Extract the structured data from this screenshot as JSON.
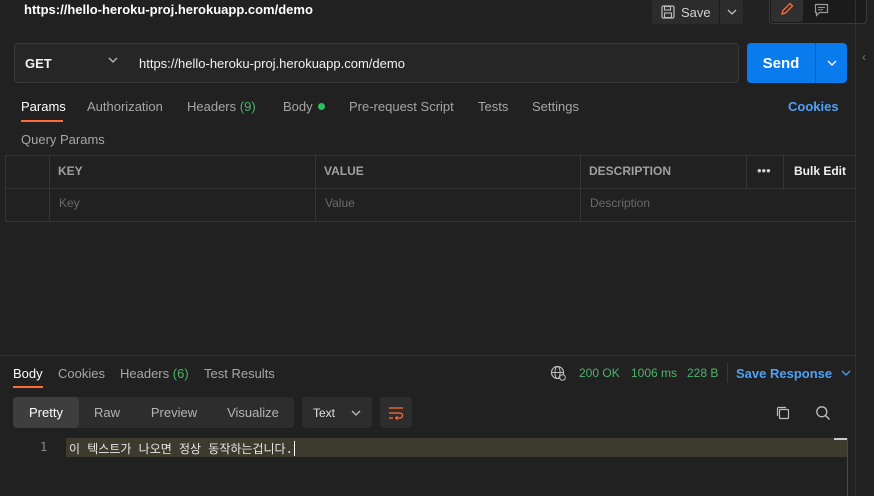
{
  "header": {
    "title": "https://hello-heroku-proj.herokuapp.com/demo",
    "save_label": "Save"
  },
  "request": {
    "method": "GET",
    "url": "https://hello-heroku-proj.herokuapp.com/demo",
    "send_label": "Send"
  },
  "request_tabs": {
    "params": "Params",
    "authorization": "Authorization",
    "headers": "Headers",
    "headers_count": "(9)",
    "body": "Body",
    "prerequest": "Pre-request Script",
    "tests": "Tests",
    "settings": "Settings",
    "cookies": "Cookies"
  },
  "query_params": {
    "title": "Query Params",
    "columns": {
      "key": "KEY",
      "value": "VALUE",
      "description": "DESCRIPTION"
    },
    "more": "•••",
    "bulk_edit": "Bulk Edit",
    "placeholders": {
      "key": "Key",
      "value": "Value",
      "description": "Description"
    }
  },
  "response_tabs": {
    "body": "Body",
    "cookies": "Cookies",
    "headers": "Headers",
    "headers_count": "(6)",
    "test_results": "Test Results"
  },
  "response_status": {
    "status": "200 OK",
    "time": "1006 ms",
    "size": "228 B",
    "save_response": "Save Response"
  },
  "view_modes": {
    "pretty": "Pretty",
    "raw": "Raw",
    "preview": "Preview",
    "visualize": "Visualize",
    "format": "Text"
  },
  "response_body": {
    "line_number": "1",
    "text": "이 텍스트가 나오면 정상 동작하는겁니다."
  },
  "colors": {
    "accent_orange": "#ff6c37",
    "send_blue": "#097bed",
    "link_blue": "#4ea2f5",
    "success_green": "#4bb36a"
  }
}
